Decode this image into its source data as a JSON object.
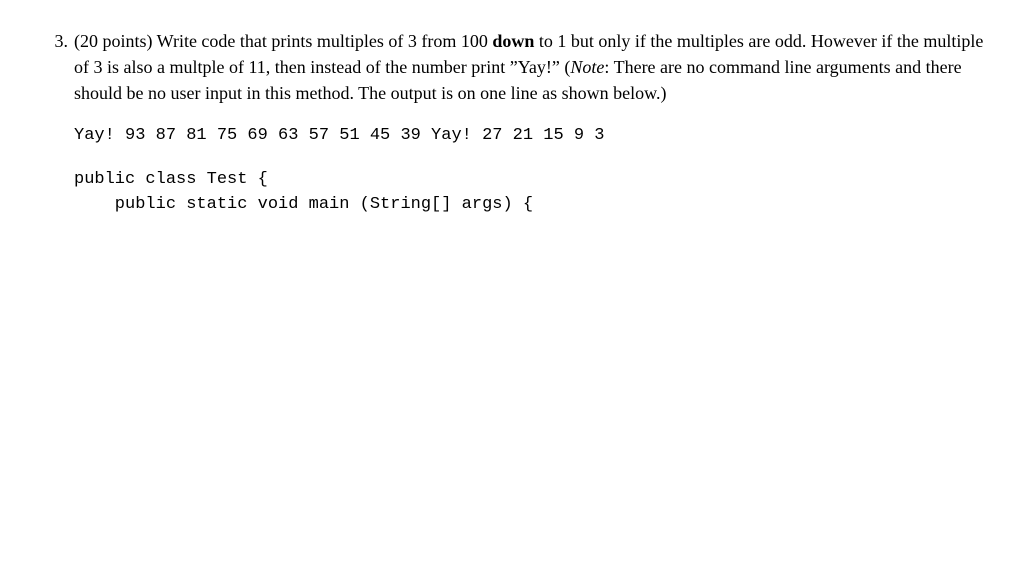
{
  "problem": {
    "number": "3.",
    "points_prefix": "(20 points)",
    "text_part1": "  Write code that prints multiples of 3 from 100 ",
    "bold_down": "down",
    "text_part2": " to 1 but only if the multiples are odd. However if the multiple of 3 is also a multple of 11, then instead of the number print ”Yay!” (",
    "note_label": "Note",
    "text_part3": ": There are no command line arguments and there should be no user input in this method. The output is on one line as shown below.)",
    "output_line": "Yay! 93 87 81 75 69 63 57 51 45 39 Yay! 27 21 15 9 3",
    "code_line1": "public class Test {",
    "code_line2": "    public static void main (String[] args) {"
  }
}
